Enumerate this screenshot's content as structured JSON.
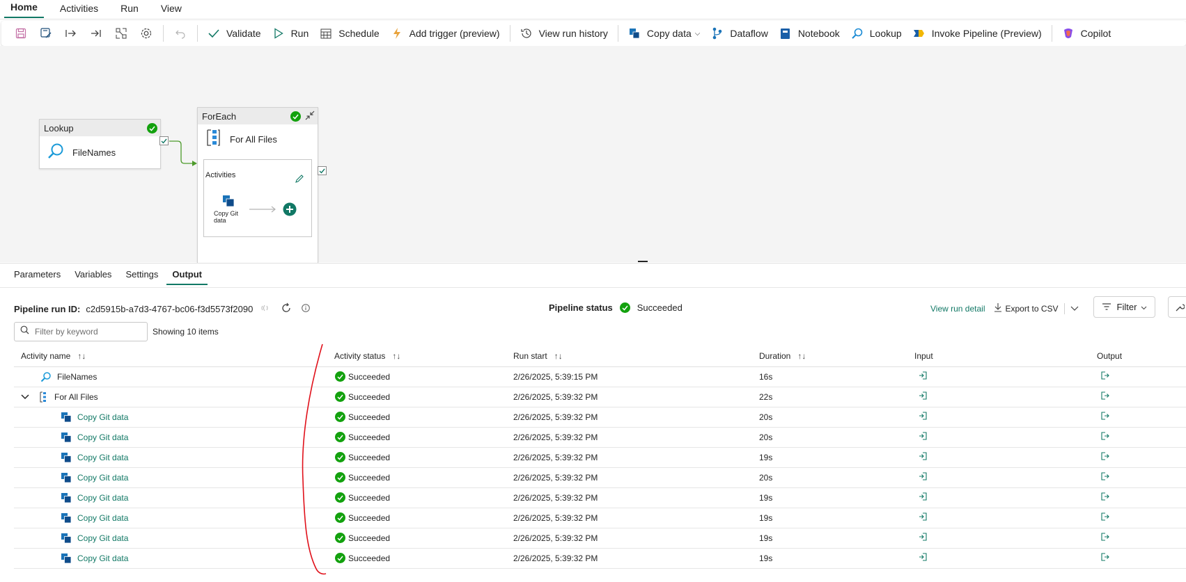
{
  "menu": {
    "tabs": [
      "Home",
      "Activities",
      "Run",
      "View"
    ],
    "active": "Home"
  },
  "toolbar": {
    "validate": "Validate",
    "run": "Run",
    "schedule": "Schedule",
    "add_trigger": "Add trigger (preview)",
    "view_run_history": "View run history",
    "copy_data": "Copy data",
    "dataflow": "Dataflow",
    "notebook": "Notebook",
    "lookup": "Lookup",
    "invoke_pipeline": "Invoke Pipeline (Preview)",
    "copilot": "Copilot"
  },
  "canvas": {
    "lookup_node": {
      "type": "Lookup",
      "name": "FileNames"
    },
    "foreach_node": {
      "type": "ForEach",
      "name": "For All Files",
      "activities_label": "Activities",
      "inner_activity": "Copy Git data"
    }
  },
  "panel": {
    "tabs": [
      "Parameters",
      "Variables",
      "Settings",
      "Output"
    ],
    "active_tab": "Output",
    "run_id_label": "Pipeline run ID:",
    "run_id": "c2d5915b-a7d3-4767-bc06-f3d5573f2090",
    "status_label": "Pipeline status",
    "status_value": "Succeeded",
    "view_run_detail": "View run detail",
    "export_csv": "Export to CSV",
    "filter": "Filter",
    "search_placeholder": "Filter by keyword",
    "showing": "Showing 10 items",
    "columns": [
      "Activity name",
      "Activity status",
      "Run start",
      "Duration",
      "Input",
      "Output"
    ],
    "rows": [
      {
        "name": "FileNames",
        "icon": "lookup-icon",
        "level": 0,
        "status": "Succeeded",
        "start": "2/26/2025, 5:39:15 PM",
        "duration": "16s"
      },
      {
        "name": "For All Files",
        "icon": "foreach-icon",
        "level": 0,
        "expandable": true,
        "status": "Succeeded",
        "start": "2/26/2025, 5:39:32 PM",
        "duration": "22s"
      },
      {
        "name": "Copy Git data",
        "icon": "copy-data-icon",
        "level": 1,
        "status": "Succeeded",
        "start": "2/26/2025, 5:39:32 PM",
        "duration": "20s"
      },
      {
        "name": "Copy Git data",
        "icon": "copy-data-icon",
        "level": 1,
        "status": "Succeeded",
        "start": "2/26/2025, 5:39:32 PM",
        "duration": "20s"
      },
      {
        "name": "Copy Git data",
        "icon": "copy-data-icon",
        "level": 1,
        "status": "Succeeded",
        "start": "2/26/2025, 5:39:32 PM",
        "duration": "19s"
      },
      {
        "name": "Copy Git data",
        "icon": "copy-data-icon",
        "level": 1,
        "status": "Succeeded",
        "start": "2/26/2025, 5:39:32 PM",
        "duration": "20s"
      },
      {
        "name": "Copy Git data",
        "icon": "copy-data-icon",
        "level": 1,
        "status": "Succeeded",
        "start": "2/26/2025, 5:39:32 PM",
        "duration": "19s"
      },
      {
        "name": "Copy Git data",
        "icon": "copy-data-icon",
        "level": 1,
        "status": "Succeeded",
        "start": "2/26/2025, 5:39:32 PM",
        "duration": "19s"
      },
      {
        "name": "Copy Git data",
        "icon": "copy-data-icon",
        "level": 1,
        "status": "Succeeded",
        "start": "2/26/2025, 5:39:32 PM",
        "duration": "19s"
      },
      {
        "name": "Copy Git data",
        "icon": "copy-data-icon",
        "level": 1,
        "status": "Succeeded",
        "start": "2/26/2025, 5:39:32 PM",
        "duration": "19s"
      }
    ]
  },
  "colors": {
    "accent": "#117865",
    "success": "#13a10e",
    "annotation": "#e0101a"
  }
}
